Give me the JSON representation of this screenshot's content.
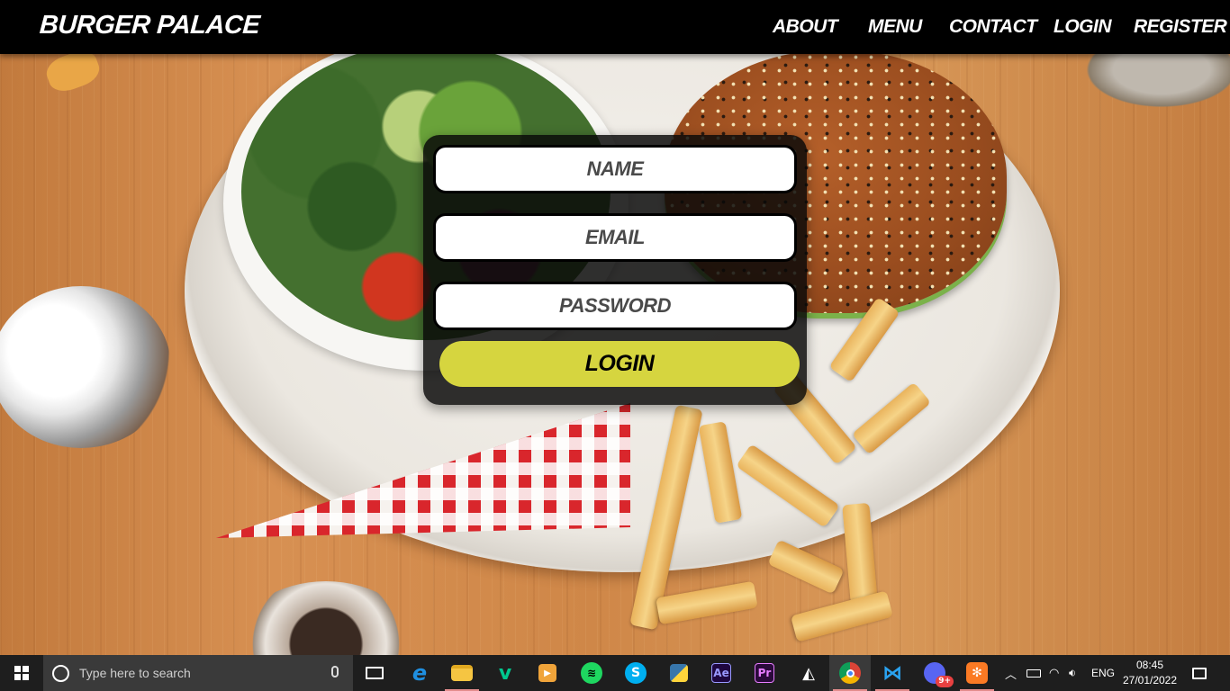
{
  "brand": {
    "name": "BURGER PALACE"
  },
  "nav": {
    "items": [
      {
        "label": "ABOUT"
      },
      {
        "label": "MENU"
      },
      {
        "label": "CONTACT"
      },
      {
        "label": "LOGIN"
      },
      {
        "label": "REGISTER"
      }
    ]
  },
  "login_form": {
    "name_placeholder": "NAME",
    "email_placeholder": "EMAIL",
    "password_placeholder": "PASSWORD",
    "submit_label": "LOGIN"
  },
  "colors": {
    "navbar_bg": "#000000",
    "login_button": "#d6d53f",
    "form_panel": "#080808"
  },
  "taskbar": {
    "search_placeholder": "Type here to search",
    "apps": [
      {
        "icon": "task-view-icon"
      },
      {
        "icon": "edge-icon"
      },
      {
        "icon": "file-explorer-icon",
        "active": true
      },
      {
        "icon": "vine-icon"
      },
      {
        "icon": "video-player-icon"
      },
      {
        "icon": "spotify-icon"
      },
      {
        "icon": "skype-icon"
      },
      {
        "icon": "python-icon"
      },
      {
        "icon": "after-effects-icon",
        "text": "Ae"
      },
      {
        "icon": "premiere-pro-icon",
        "text": "Pr"
      },
      {
        "icon": "inkscape-icon"
      },
      {
        "icon": "chrome-icon",
        "active": true,
        "open": true
      },
      {
        "icon": "vscode-icon",
        "active": true
      },
      {
        "icon": "discord-icon",
        "badge": "9+"
      },
      {
        "icon": "xampp-icon",
        "active": true
      }
    ],
    "tray": {
      "language": "ENG",
      "time": "08:45",
      "date": "27/01/2022"
    }
  }
}
